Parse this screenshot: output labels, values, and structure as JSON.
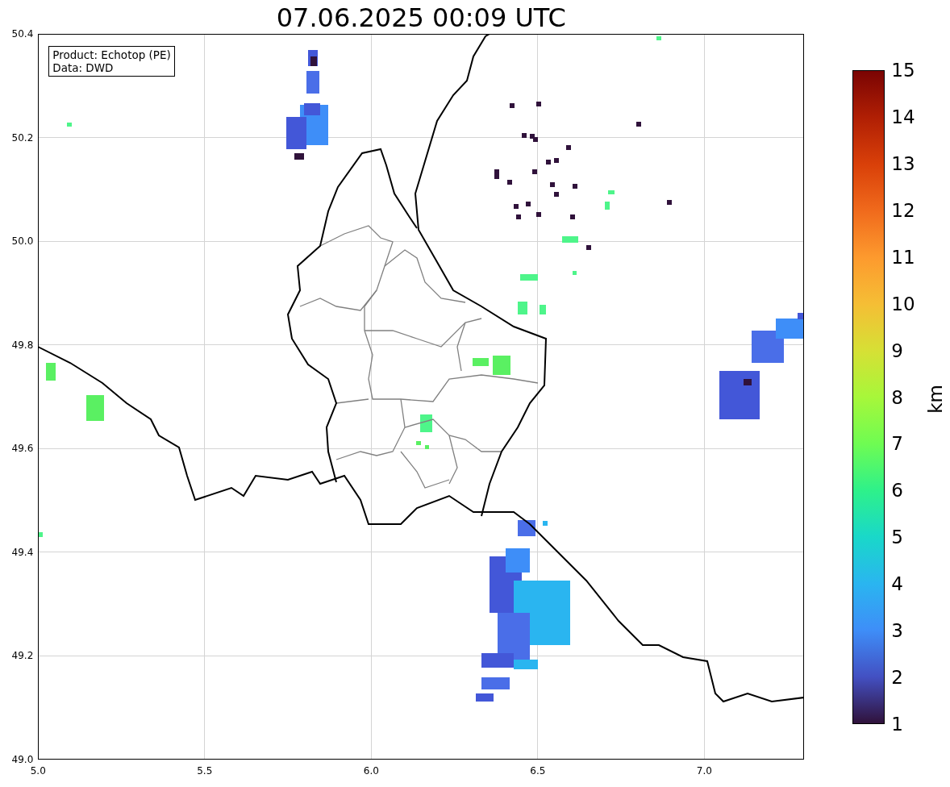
{
  "title": "07.06.2025 00:09 UTC",
  "info_box": {
    "lines": [
      "Product: Echotop (PE)",
      "Data: DWD"
    ]
  },
  "map": {
    "xticks": [
      "5.0",
      "5.5",
      "6.0",
      "6.5",
      "7.0"
    ],
    "yticks": [
      "50.4",
      "50.2",
      "50.0",
      "49.8",
      "49.6",
      "49.4",
      "49.2",
      "49.0"
    ]
  },
  "colorbar": {
    "ticks": [
      "15",
      "14",
      "13",
      "12",
      "11",
      "10",
      "9",
      "8",
      "7",
      "6",
      "5",
      "4",
      "3",
      "2",
      "1"
    ],
    "label": "km"
  }
}
